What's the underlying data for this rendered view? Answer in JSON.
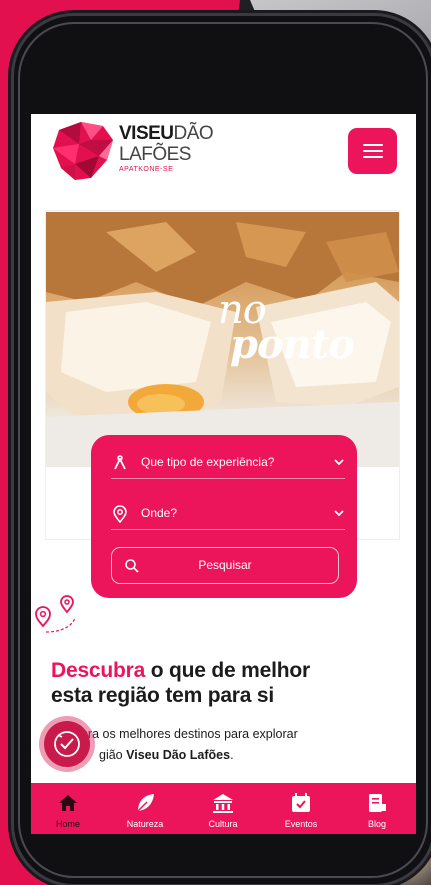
{
  "brand": {
    "line1_strong": "VISEU",
    "line1_light": "DÃO",
    "line2": "LAFÕES",
    "line3": "APATKONE-SE"
  },
  "header": {
    "menu_icon": "hamburger-icon"
  },
  "hero": {
    "line1": "no",
    "line2": "ponto"
  },
  "search": {
    "experience_label": "Que tipo de experiência?",
    "where_label": "Onde?",
    "button_label": "Pesquisar"
  },
  "discover": {
    "title_accent": "Descubra",
    "title_rest_1": " o que de melhor",
    "title_line2": "esta região tem para si",
    "text_prefix": "ubra os melhores destinos para explorar",
    "text_line2_prefix": "gião ",
    "text_bold": "Viseu Dão Lafões",
    "text_suffix": "."
  },
  "bottom_nav": {
    "items": [
      {
        "label": "Home",
        "icon": "home-icon"
      },
      {
        "label": "Natureza",
        "icon": "leaf-icon"
      },
      {
        "label": "Cultura",
        "icon": "museum-icon"
      },
      {
        "label": "Eventos",
        "icon": "calendar-icon"
      },
      {
        "label": "Blog",
        "icon": "blog-icon"
      }
    ]
  },
  "colors": {
    "accent": "#ec145a",
    "background_red": "#e3104f",
    "text_dark": "#1c1c1c"
  }
}
